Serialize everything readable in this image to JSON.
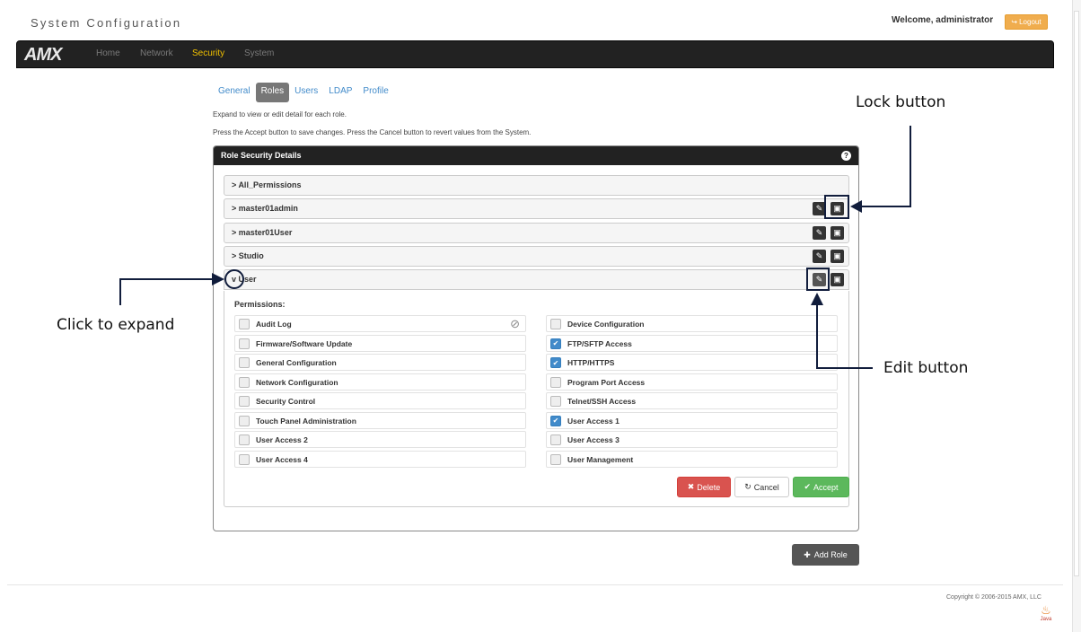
{
  "header": {
    "title": "System Configuration",
    "welcome": "Welcome, administrator",
    "logout_label": "Logout"
  },
  "navbar": {
    "brand": "AMX",
    "items": [
      {
        "label": "Home",
        "active": false
      },
      {
        "label": "Network",
        "active": false
      },
      {
        "label": "Security",
        "active": true
      },
      {
        "label": "System",
        "active": false
      }
    ]
  },
  "tabs": [
    {
      "label": "General",
      "active": false
    },
    {
      "label": "Roles",
      "active": true
    },
    {
      "label": "Users",
      "active": false
    },
    {
      "label": "LDAP",
      "active": false
    },
    {
      "label": "Profile",
      "active": false
    }
  ],
  "hints": {
    "expand": "Expand to view or edit detail for each role.",
    "accept": "Press the Accept button to save changes. Press the Cancel button to revert values from the System."
  },
  "panel": {
    "title": "Role Security Details",
    "help_icon": "question-circle-icon",
    "roles": [
      {
        "name": "All_Permissions",
        "expanded": false,
        "has_buttons": false
      },
      {
        "name": "master01admin",
        "expanded": false,
        "has_buttons": true
      },
      {
        "name": "master01User",
        "expanded": false,
        "has_buttons": true
      },
      {
        "name": "Studio",
        "expanded": false,
        "has_buttons": true
      },
      {
        "name": "User",
        "expanded": true,
        "has_buttons": true
      }
    ],
    "permissions_title": "Permissions:",
    "permissions_left": [
      {
        "label": "Audit Log",
        "checked": false,
        "disabled_icon": true
      },
      {
        "label": "Firmware/Software Update",
        "checked": false
      },
      {
        "label": "General Configuration",
        "checked": false
      },
      {
        "label": "Network Configuration",
        "checked": false
      },
      {
        "label": "Security Control",
        "checked": false
      },
      {
        "label": "Touch Panel Administration",
        "checked": false
      },
      {
        "label": "User Access 2",
        "checked": false
      },
      {
        "label": "User Access 4",
        "checked": false
      }
    ],
    "permissions_right": [
      {
        "label": "Device Configuration",
        "checked": false
      },
      {
        "label": "FTP/SFTP Access",
        "checked": true
      },
      {
        "label": "HTTP/HTTPS",
        "checked": true
      },
      {
        "label": "Program Port Access",
        "checked": false
      },
      {
        "label": "Telnet/SSH Access",
        "checked": false
      },
      {
        "label": "User Access 1",
        "checked": true
      },
      {
        "label": "User Access 3",
        "checked": false
      },
      {
        "label": "User Management",
        "checked": false
      }
    ],
    "buttons": {
      "delete": "Delete",
      "cancel": "Cancel",
      "accept": "Accept"
    }
  },
  "add_role_label": "Add Role",
  "footer": {
    "copyright": "Copyright © 2006-2015 AMX, LLC",
    "java_label": "Java"
  },
  "annotations": {
    "lock": "Lock button",
    "expand": "Click to expand",
    "edit": "Edit button"
  },
  "colors": {
    "navbar": "#222222",
    "active_nav": "#f0c000",
    "logout": "#f0ad4e",
    "delete": "#d9534f",
    "accept": "#5cb85c",
    "checked": "#428bca"
  }
}
